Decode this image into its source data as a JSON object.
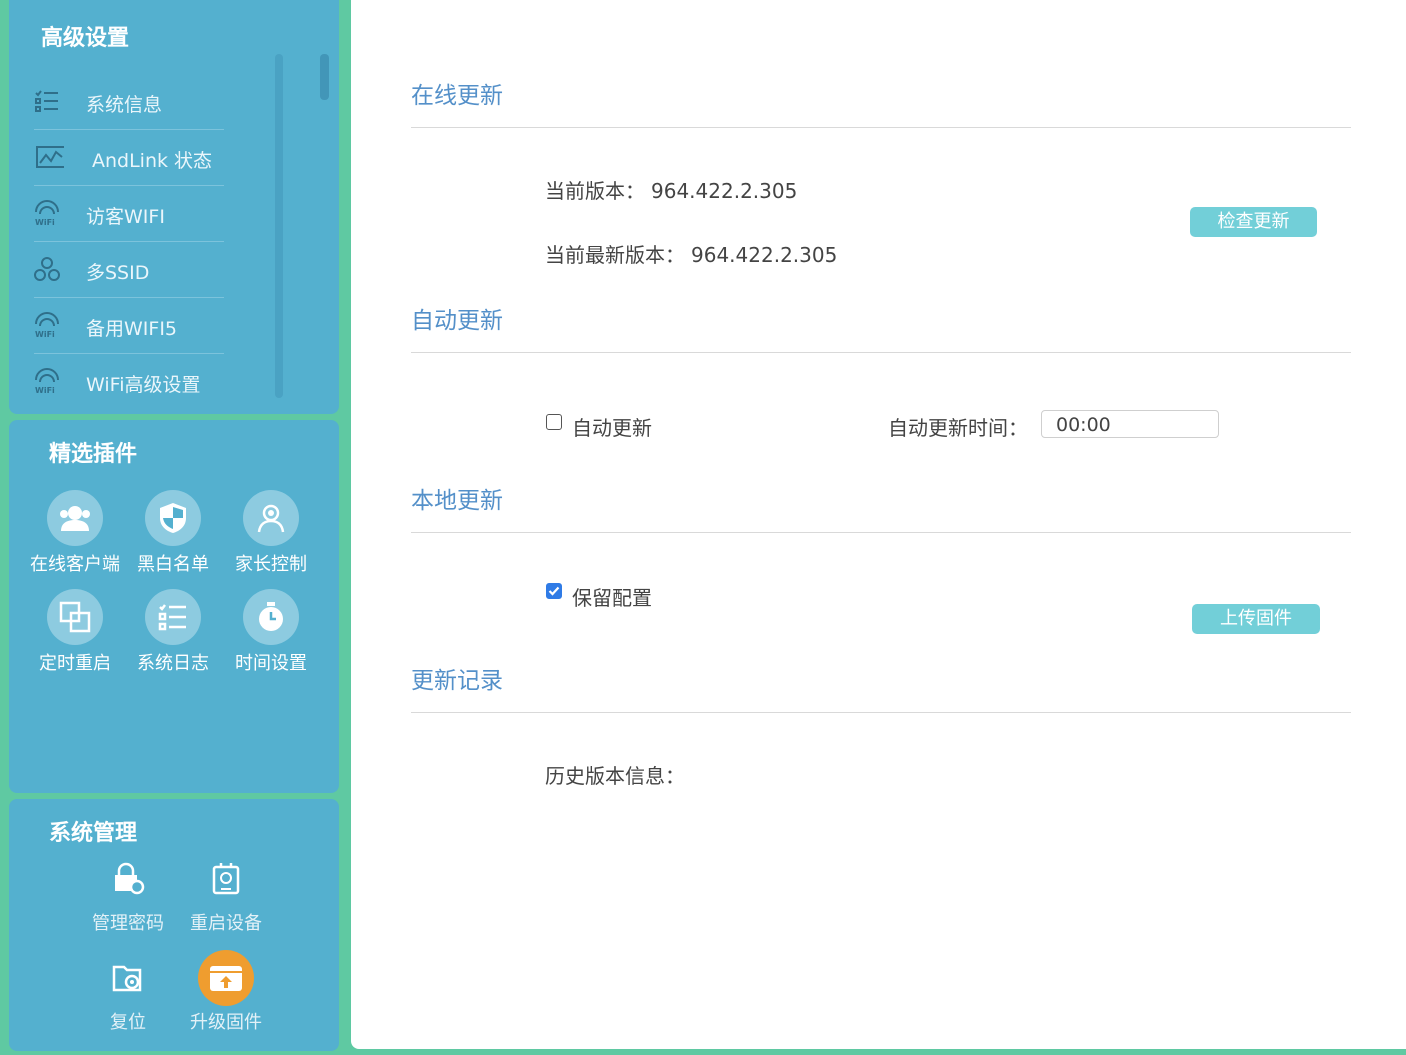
{
  "sidebar": {
    "advanced": {
      "title": "高级设置",
      "items": [
        {
          "label": "系统信息",
          "icon": "list-icon"
        },
        {
          "label": "AndLink 状态",
          "icon": "chart-icon"
        },
        {
          "label": "访客WIFI",
          "icon": "wifi-icon"
        },
        {
          "label": "多SSID",
          "icon": "nodes-icon"
        },
        {
          "label": "备用WIFI5",
          "icon": "wifi-icon"
        },
        {
          "label": "WiFi高级设置",
          "icon": "wifi-icon"
        }
      ]
    },
    "plugins": {
      "title": "精选插件",
      "items": [
        {
          "label": "在线客户端",
          "icon": "users-icon"
        },
        {
          "label": "黑白名单",
          "icon": "shield-icon"
        },
        {
          "label": "家长控制",
          "icon": "parent-icon"
        },
        {
          "label": "定时重启",
          "icon": "restart-icon"
        },
        {
          "label": "系统日志",
          "icon": "log-icon"
        },
        {
          "label": "时间设置",
          "icon": "stopwatch-icon"
        }
      ]
    },
    "system": {
      "title": "系统管理",
      "items": [
        {
          "label": "管理密码",
          "icon": "lock-gear-icon"
        },
        {
          "label": "重启设备",
          "icon": "device-icon"
        },
        {
          "label": "复位",
          "icon": "folder-gear-icon"
        },
        {
          "label": "升级固件",
          "icon": "upload-icon",
          "active": true
        }
      ]
    }
  },
  "main": {
    "online_update": {
      "title": "在线更新",
      "current_label": "当前版本：",
      "current_version": "964.422.2.305",
      "latest_label": "当前最新版本：",
      "latest_version": "964.422.2.305",
      "check_button": "检查更新"
    },
    "auto_update": {
      "title": "自动更新",
      "checkbox_label": "自动更新",
      "checked": false,
      "time_label": "自动更新时间：",
      "time_value": "00:00"
    },
    "local_update": {
      "title": "本地更新",
      "keep_config_label": "保留配置",
      "keep_config_checked": true,
      "upload_button": "上传固件"
    },
    "history": {
      "title": "更新记录",
      "history_label": "历史版本信息："
    }
  },
  "colors": {
    "sidebar_bg": "#54b0cf",
    "page_bg": "#5fc9a2",
    "section_title": "#5490c9",
    "button": "#72cfd8",
    "active_icon": "#ef9d2f"
  }
}
